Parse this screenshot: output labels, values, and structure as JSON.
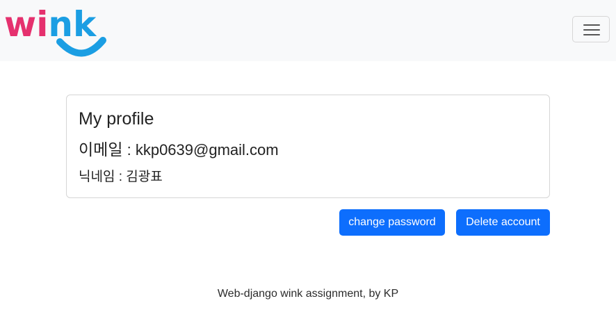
{
  "navbar": {
    "logo_text": "wink",
    "brand_colors": {
      "pink": "#e5316e",
      "blue": "#1b9ee3"
    },
    "menu_icon": "hamburger-icon"
  },
  "profile": {
    "title": "My profile",
    "email_label": "이메일",
    "email_separator": " : ",
    "email_value": "kkp0639@gmail.com",
    "nickname_label": "닉네임",
    "nickname_separator": " : ",
    "nickname_value": "김광표"
  },
  "actions": {
    "change_password_label": "change password",
    "delete_account_label": "Delete account",
    "button_color": "#0d6efd"
  },
  "footer": {
    "text": "Web-django wink assignment, by KP"
  }
}
